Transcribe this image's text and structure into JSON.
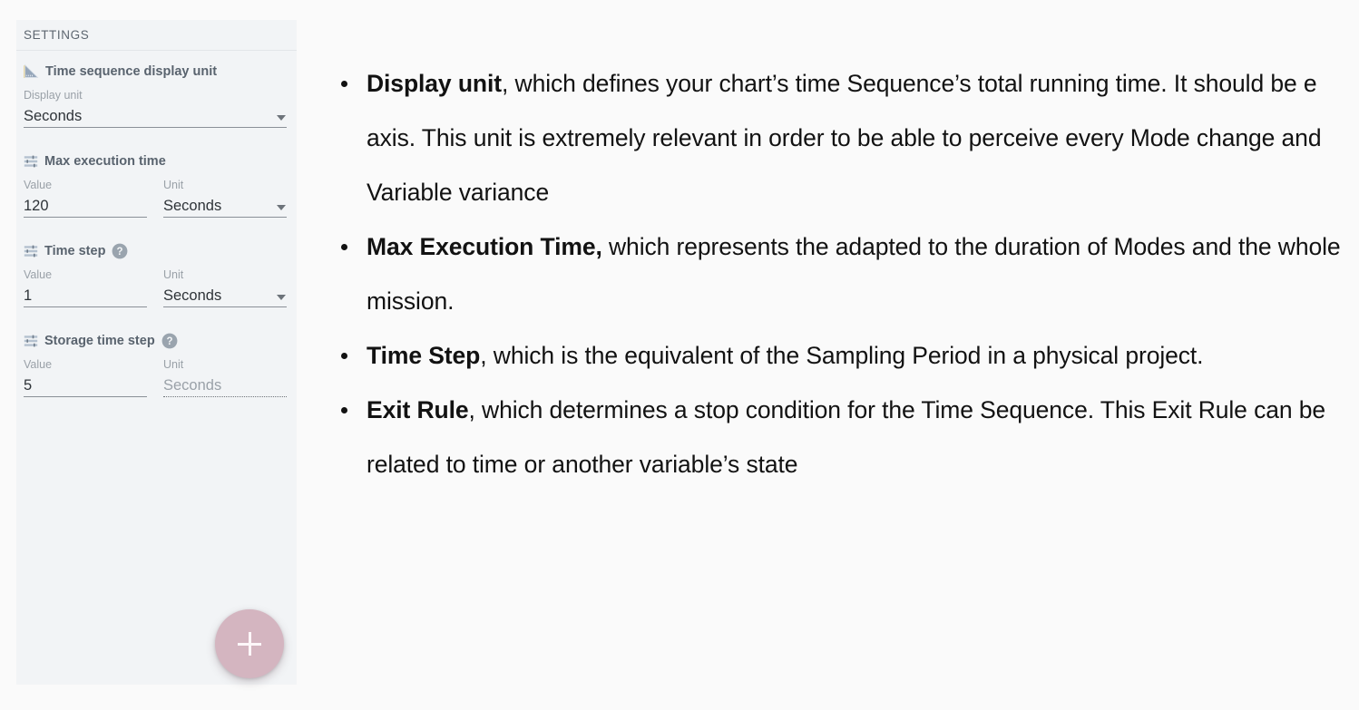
{
  "panel": {
    "header_title": "SETTINGS",
    "sections": [
      {
        "icon": "ruler-triangle-icon",
        "title": "Time sequence display unit",
        "has_help": false,
        "fields": [
          {
            "label": "Display unit",
            "value": "Seconds",
            "type": "select",
            "disabled": false
          }
        ]
      },
      {
        "icon": "tune-icon",
        "title": "Max execution time",
        "has_help": false,
        "fields": [
          {
            "label": "Value",
            "value": "120",
            "type": "text",
            "disabled": false
          },
          {
            "label": "Unit",
            "value": "Seconds",
            "type": "select",
            "disabled": false
          }
        ]
      },
      {
        "icon": "tune-icon",
        "title": "Time step",
        "has_help": true,
        "fields": [
          {
            "label": "Value",
            "value": "1",
            "type": "text",
            "disabled": false
          },
          {
            "label": "Unit",
            "value": "Seconds",
            "type": "select",
            "disabled": false
          }
        ]
      },
      {
        "icon": "tune-icon",
        "title": "Storage time step",
        "has_help": true,
        "fields": [
          {
            "label": "Value",
            "value": "5",
            "type": "text",
            "disabled": false
          },
          {
            "label": "Unit",
            "value": "Seconds",
            "type": "text",
            "disabled": true
          }
        ]
      }
    ],
    "add_button": {
      "icon": "plus-icon",
      "label": "+"
    }
  },
  "content": {
    "bullets": [
      {
        "term": "Display unit",
        "rest": ", which defines your chart’s time Sequence’s total running time. It should be e axis. This unit is extremely relevant in order to be able to perceive every Mode change and Variable variance"
      },
      {
        "term": "Max Execution Time,",
        "rest": " which represents the adapted to the duration of Modes and the whole mission."
      },
      {
        "term": "Time Step",
        "rest": ", which is the equivalent of the Sampling Period in a physical project."
      },
      {
        "term": "Exit Rule",
        "rest": ", which determines a stop condition for the Time Sequence. This Exit Rule can be related to time or another variable’s state"
      }
    ]
  },
  "colors": {
    "panel_background": "#f2f4f6",
    "page_background": "#fafafa",
    "fab_background": "#d4b5c0",
    "section_title": "#59636e",
    "muted_label": "#9aa1a8",
    "icon_blue_gray": "#8b9bb0"
  }
}
